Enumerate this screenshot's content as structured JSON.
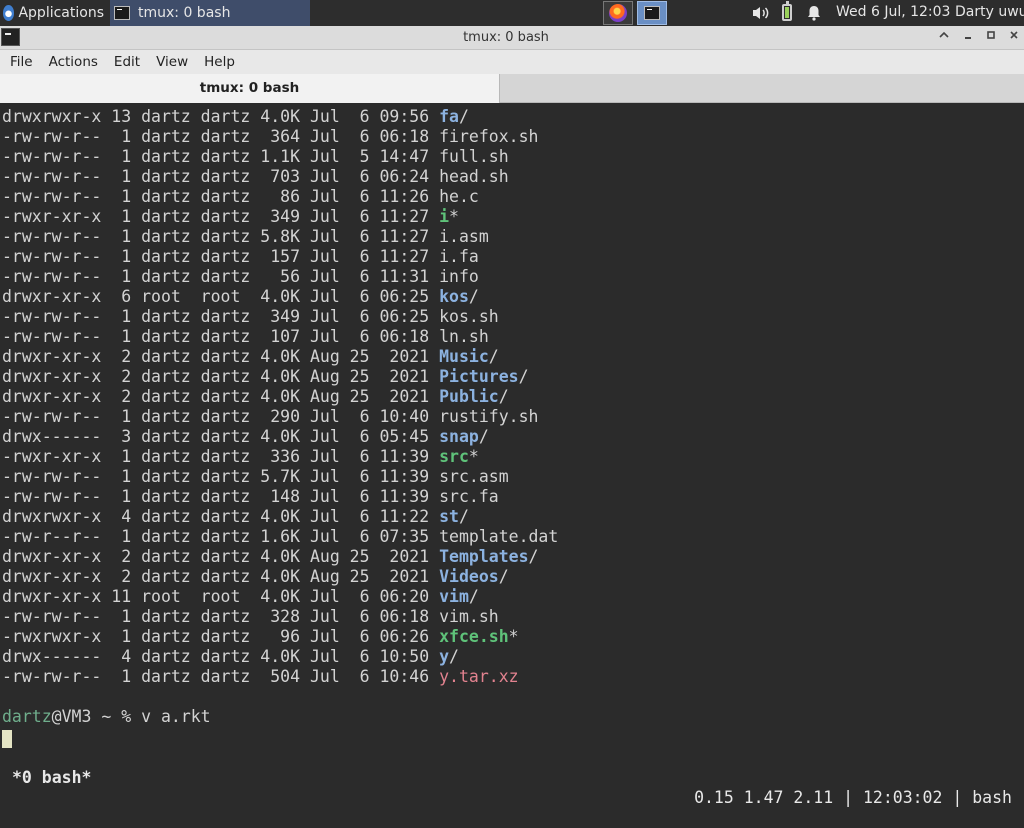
{
  "panel": {
    "applications_label": "Applications",
    "task_title": "tmux: 0 bash",
    "clock": "Wed  6 Jul, 12:03",
    "user": "Darty uwu",
    "battery_level": 0.85
  },
  "window": {
    "title": "tmux: 0 bash"
  },
  "menu": [
    "File",
    "Actions",
    "Edit",
    "View",
    "Help"
  ],
  "tabs": [
    {
      "label": "tmux: 0 bash"
    }
  ],
  "listing": [
    {
      "perm": "drwxrwxr-x",
      "links": "13",
      "owner": "dartz",
      "group": "dartz",
      "size": "4.0K",
      "month": "Jul",
      "day": "6",
      "time": "09:56",
      "name": "fa",
      "suffix": "/",
      "kind": "dir"
    },
    {
      "perm": "-rw-rw-r--",
      "links": "1",
      "owner": "dartz",
      "group": "dartz",
      "size": "364",
      "month": "Jul",
      "day": "6",
      "time": "06:18",
      "name": "firefox.sh",
      "suffix": "",
      "kind": "file"
    },
    {
      "perm": "-rw-rw-r--",
      "links": "1",
      "owner": "dartz",
      "group": "dartz",
      "size": "1.1K",
      "month": "Jul",
      "day": "5",
      "time": "14:47",
      "name": "full.sh",
      "suffix": "",
      "kind": "file"
    },
    {
      "perm": "-rw-rw-r--",
      "links": "1",
      "owner": "dartz",
      "group": "dartz",
      "size": "703",
      "month": "Jul",
      "day": "6",
      "time": "06:24",
      "name": "head.sh",
      "suffix": "",
      "kind": "file"
    },
    {
      "perm": "-rw-rw-r--",
      "links": "1",
      "owner": "dartz",
      "group": "dartz",
      "size": "86",
      "month": "Jul",
      "day": "6",
      "time": "11:26",
      "name": "he.c",
      "suffix": "",
      "kind": "file"
    },
    {
      "perm": "-rwxr-xr-x",
      "links": "1",
      "owner": "dartz",
      "group": "dartz",
      "size": "349",
      "month": "Jul",
      "day": "6",
      "time": "11:27",
      "name": "i",
      "suffix": "*",
      "kind": "exec"
    },
    {
      "perm": "-rw-rw-r--",
      "links": "1",
      "owner": "dartz",
      "group": "dartz",
      "size": "5.8K",
      "month": "Jul",
      "day": "6",
      "time": "11:27",
      "name": "i.asm",
      "suffix": "",
      "kind": "file"
    },
    {
      "perm": "-rw-rw-r--",
      "links": "1",
      "owner": "dartz",
      "group": "dartz",
      "size": "157",
      "month": "Jul",
      "day": "6",
      "time": "11:27",
      "name": "i.fa",
      "suffix": "",
      "kind": "file"
    },
    {
      "perm": "-rw-rw-r--",
      "links": "1",
      "owner": "dartz",
      "group": "dartz",
      "size": "56",
      "month": "Jul",
      "day": "6",
      "time": "11:31",
      "name": "info",
      "suffix": "",
      "kind": "file"
    },
    {
      "perm": "drwxr-xr-x",
      "links": "6",
      "owner": "root",
      "group": "root",
      "size": "4.0K",
      "month": "Jul",
      "day": "6",
      "time": "06:25",
      "name": "kos",
      "suffix": "/",
      "kind": "dir"
    },
    {
      "perm": "-rw-rw-r--",
      "links": "1",
      "owner": "dartz",
      "group": "dartz",
      "size": "349",
      "month": "Jul",
      "day": "6",
      "time": "06:25",
      "name": "kos.sh",
      "suffix": "",
      "kind": "file"
    },
    {
      "perm": "-rw-rw-r--",
      "links": "1",
      "owner": "dartz",
      "group": "dartz",
      "size": "107",
      "month": "Jul",
      "day": "6",
      "time": "06:18",
      "name": "ln.sh",
      "suffix": "",
      "kind": "file"
    },
    {
      "perm": "drwxr-xr-x",
      "links": "2",
      "owner": "dartz",
      "group": "dartz",
      "size": "4.0K",
      "month": "Aug",
      "day": "25",
      "time": "2021",
      "name": "Music",
      "suffix": "/",
      "kind": "dir"
    },
    {
      "perm": "drwxr-xr-x",
      "links": "2",
      "owner": "dartz",
      "group": "dartz",
      "size": "4.0K",
      "month": "Aug",
      "day": "25",
      "time": "2021",
      "name": "Pictures",
      "suffix": "/",
      "kind": "dir"
    },
    {
      "perm": "drwxr-xr-x",
      "links": "2",
      "owner": "dartz",
      "group": "dartz",
      "size": "4.0K",
      "month": "Aug",
      "day": "25",
      "time": "2021",
      "name": "Public",
      "suffix": "/",
      "kind": "dir"
    },
    {
      "perm": "-rw-rw-r--",
      "links": "1",
      "owner": "dartz",
      "group": "dartz",
      "size": "290",
      "month": "Jul",
      "day": "6",
      "time": "10:40",
      "name": "rustify.sh",
      "suffix": "",
      "kind": "file"
    },
    {
      "perm": "drwx------",
      "links": "3",
      "owner": "dartz",
      "group": "dartz",
      "size": "4.0K",
      "month": "Jul",
      "day": "6",
      "time": "05:45",
      "name": "snap",
      "suffix": "/",
      "kind": "dir"
    },
    {
      "perm": "-rwxr-xr-x",
      "links": "1",
      "owner": "dartz",
      "group": "dartz",
      "size": "336",
      "month": "Jul",
      "day": "6",
      "time": "11:39",
      "name": "src",
      "suffix": "*",
      "kind": "exec"
    },
    {
      "perm": "-rw-rw-r--",
      "links": "1",
      "owner": "dartz",
      "group": "dartz",
      "size": "5.7K",
      "month": "Jul",
      "day": "6",
      "time": "11:39",
      "name": "src.asm",
      "suffix": "",
      "kind": "file"
    },
    {
      "perm": "-rw-rw-r--",
      "links": "1",
      "owner": "dartz",
      "group": "dartz",
      "size": "148",
      "month": "Jul",
      "day": "6",
      "time": "11:39",
      "name": "src.fa",
      "suffix": "",
      "kind": "file"
    },
    {
      "perm": "drwxrwxr-x",
      "links": "4",
      "owner": "dartz",
      "group": "dartz",
      "size": "4.0K",
      "month": "Jul",
      "day": "6",
      "time": "11:22",
      "name": "st",
      "suffix": "/",
      "kind": "dir"
    },
    {
      "perm": "-rw-r--r--",
      "links": "1",
      "owner": "dartz",
      "group": "dartz",
      "size": "1.6K",
      "month": "Jul",
      "day": "6",
      "time": "07:35",
      "name": "template.dat",
      "suffix": "",
      "kind": "file"
    },
    {
      "perm": "drwxr-xr-x",
      "links": "2",
      "owner": "dartz",
      "group": "dartz",
      "size": "4.0K",
      "month": "Aug",
      "day": "25",
      "time": "2021",
      "name": "Templates",
      "suffix": "/",
      "kind": "dir"
    },
    {
      "perm": "drwxr-xr-x",
      "links": "2",
      "owner": "dartz",
      "group": "dartz",
      "size": "4.0K",
      "month": "Aug",
      "day": "25",
      "time": "2021",
      "name": "Videos",
      "suffix": "/",
      "kind": "dir"
    },
    {
      "perm": "drwxr-xr-x",
      "links": "11",
      "owner": "root",
      "group": "root",
      "size": "4.0K",
      "month": "Jul",
      "day": "6",
      "time": "06:20",
      "name": "vim",
      "suffix": "/",
      "kind": "dir"
    },
    {
      "perm": "-rw-rw-r--",
      "links": "1",
      "owner": "dartz",
      "group": "dartz",
      "size": "328",
      "month": "Jul",
      "day": "6",
      "time": "06:18",
      "name": "vim.sh",
      "suffix": "",
      "kind": "file"
    },
    {
      "perm": "-rwxrwxr-x",
      "links": "1",
      "owner": "dartz",
      "group": "dartz",
      "size": "96",
      "month": "Jul",
      "day": "6",
      "time": "06:26",
      "name": "xfce.sh",
      "suffix": "*",
      "kind": "exec"
    },
    {
      "perm": "drwx------",
      "links": "4",
      "owner": "dartz",
      "group": "dartz",
      "size": "4.0K",
      "month": "Jul",
      "day": "6",
      "time": "10:50",
      "name": "y",
      "suffix": "/",
      "kind": "dir"
    },
    {
      "perm": "-rw-rw-r--",
      "links": "1",
      "owner": "dartz",
      "group": "dartz",
      "size": "504",
      "month": "Jul",
      "day": "6",
      "time": "10:46",
      "name": "y.tar.xz",
      "suffix": "",
      "kind": "arch"
    }
  ],
  "prompt": {
    "user": "dartz",
    "rest": "@VM3 ~ % ",
    "command": "v a.rkt"
  },
  "tmux_status": {
    "window": "*0 bash*",
    "load": "0.15 1.47 2.11",
    "time": "12:03:02",
    "session": "bash",
    "separator": " | "
  },
  "colors": {
    "dir": "#8cb2e0",
    "exec": "#5fc37a",
    "archive": "#e2828f",
    "prompt_user": "#6fae8c",
    "terminal_bg": "#2b2b2b"
  }
}
